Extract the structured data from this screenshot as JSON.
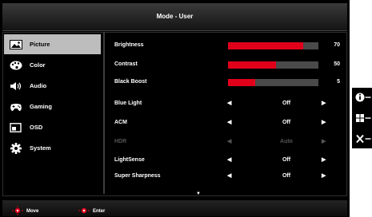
{
  "header": {
    "title": "Mode - User"
  },
  "sidebar": {
    "items": [
      {
        "label": "Picture",
        "icon": "picture-icon",
        "selected": true
      },
      {
        "label": "Color",
        "icon": "palette-icon",
        "selected": false
      },
      {
        "label": "Audio",
        "icon": "speaker-icon",
        "selected": false
      },
      {
        "label": "Gaming",
        "icon": "gamepad-icon",
        "selected": false
      },
      {
        "label": "OSD",
        "icon": "osd-window-icon",
        "selected": false
      },
      {
        "label": "System",
        "icon": "gear-icon",
        "selected": false
      }
    ]
  },
  "settings": {
    "brightness": {
      "label": "Brightness",
      "value": "70",
      "level": 0.83
    },
    "contrast": {
      "label": "Contrast",
      "value": "50",
      "level": 0.53
    },
    "black_boost": {
      "label": "Black Boost",
      "value": "5",
      "level": 0.3
    },
    "blue_light": {
      "label": "Blue Light",
      "value": "Off"
    },
    "acm": {
      "label": "ACM",
      "value": "Off"
    },
    "hdr": {
      "label": "HDR",
      "value": "Auto",
      "disabled": true
    },
    "lightsense": {
      "label": "LightSense",
      "value": "Off"
    },
    "super_sharpness": {
      "label": "Super Sharpness",
      "value": "Off"
    }
  },
  "footer": {
    "move_label": "Move",
    "enter_label": "Enter"
  },
  "colors": {
    "accent": "#e1001a",
    "selected_bg": "#bdbdbd",
    "panel_bg": "#000000"
  },
  "right_keys": [
    "info-icon",
    "input-grid-icon",
    "exit-icon"
  ]
}
